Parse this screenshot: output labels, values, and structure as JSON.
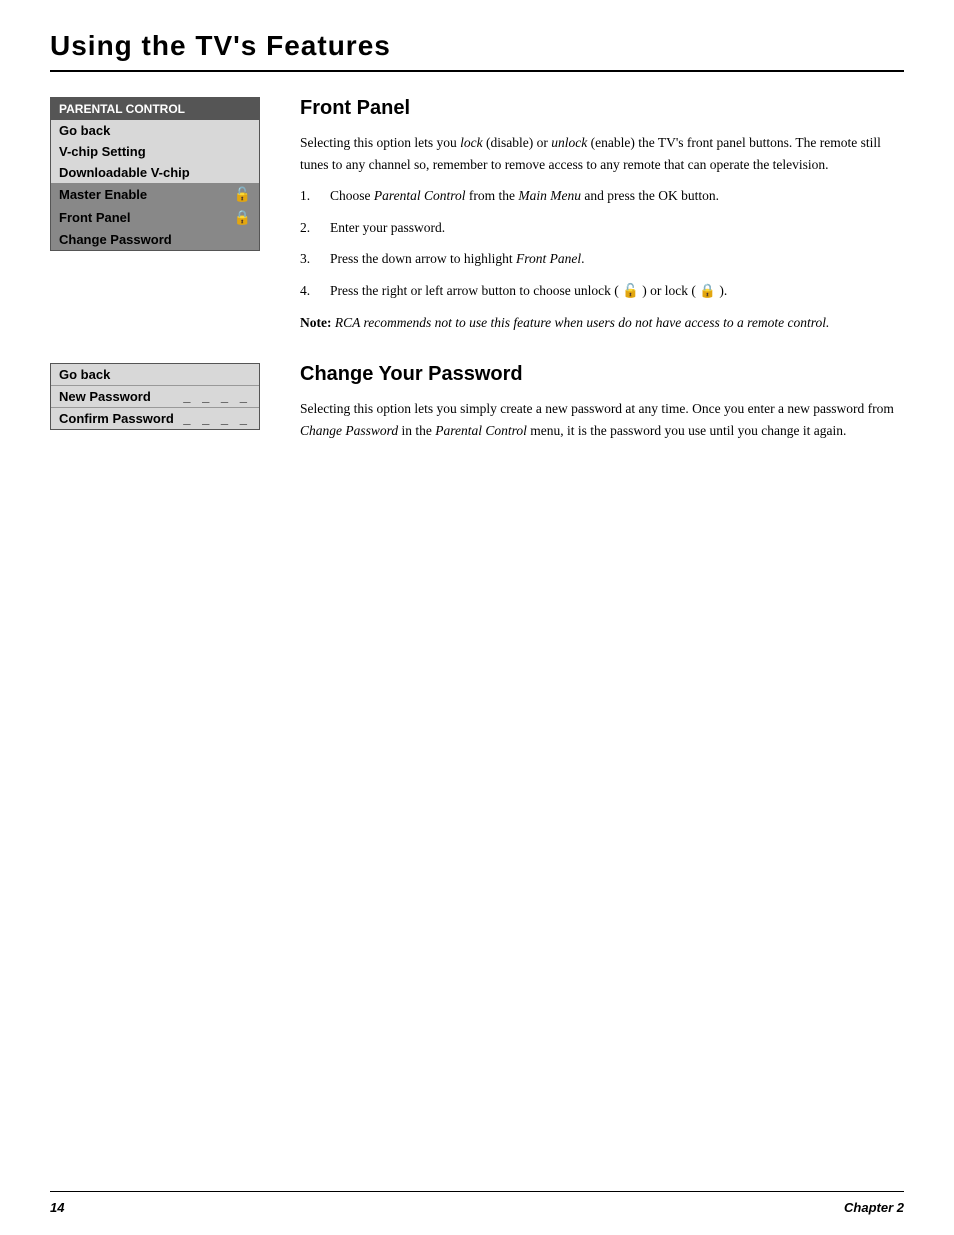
{
  "page": {
    "title": "Using the TV's Features",
    "page_number": "14",
    "chapter": "Chapter 2"
  },
  "parental_menu": {
    "header": "PARENTAL CONTROL",
    "items": [
      {
        "label": "Go back",
        "icon": null,
        "highlight": false
      },
      {
        "label": "V-chip Setting",
        "icon": null,
        "highlight": false
      },
      {
        "label": "Downloadable V-chip",
        "icon": null,
        "highlight": false
      },
      {
        "label": "Master Enable",
        "icon": "unlock",
        "highlight": true
      },
      {
        "label": "Front Panel",
        "icon": "lock",
        "highlight": true
      },
      {
        "label": "Change Password",
        "icon": null,
        "highlight": true
      }
    ]
  },
  "front_panel_section": {
    "heading": "Front Panel",
    "intro": "Selecting this option lets you lock (disable) or unlock (enable) the TV's front panel buttons. The remote still tunes to any channel so, remember to remove access to any remote that can operate the television.",
    "steps": [
      {
        "num": "1.",
        "text": "Choose Parental Control from the Main Menu and press the OK button."
      },
      {
        "num": "2.",
        "text": "Enter your password."
      },
      {
        "num": "3.",
        "text": "Press the down arrow to highlight Front Panel."
      },
      {
        "num": "4.",
        "text": "Press the right or left arrow button to choose unlock (🔓) or lock (🔒)."
      }
    ],
    "note": "Note: RCA recommends not to use this feature when users do not have access to a remote control."
  },
  "change_password_menu": {
    "items": [
      {
        "label": "Go back",
        "dashes": null,
        "highlight": false
      },
      {
        "label": "New Password",
        "dashes": "_ _ _ _",
        "highlight": false
      },
      {
        "label": "Confirm Password",
        "dashes": "_ _ _ _",
        "highlight": false
      }
    ]
  },
  "change_password_section": {
    "heading": "Change Your Password",
    "text": "Selecting this option lets you simply create a new password at any time. Once you enter a new password from Change Password in the Parental Control menu, it is the password you use until you change it again."
  }
}
